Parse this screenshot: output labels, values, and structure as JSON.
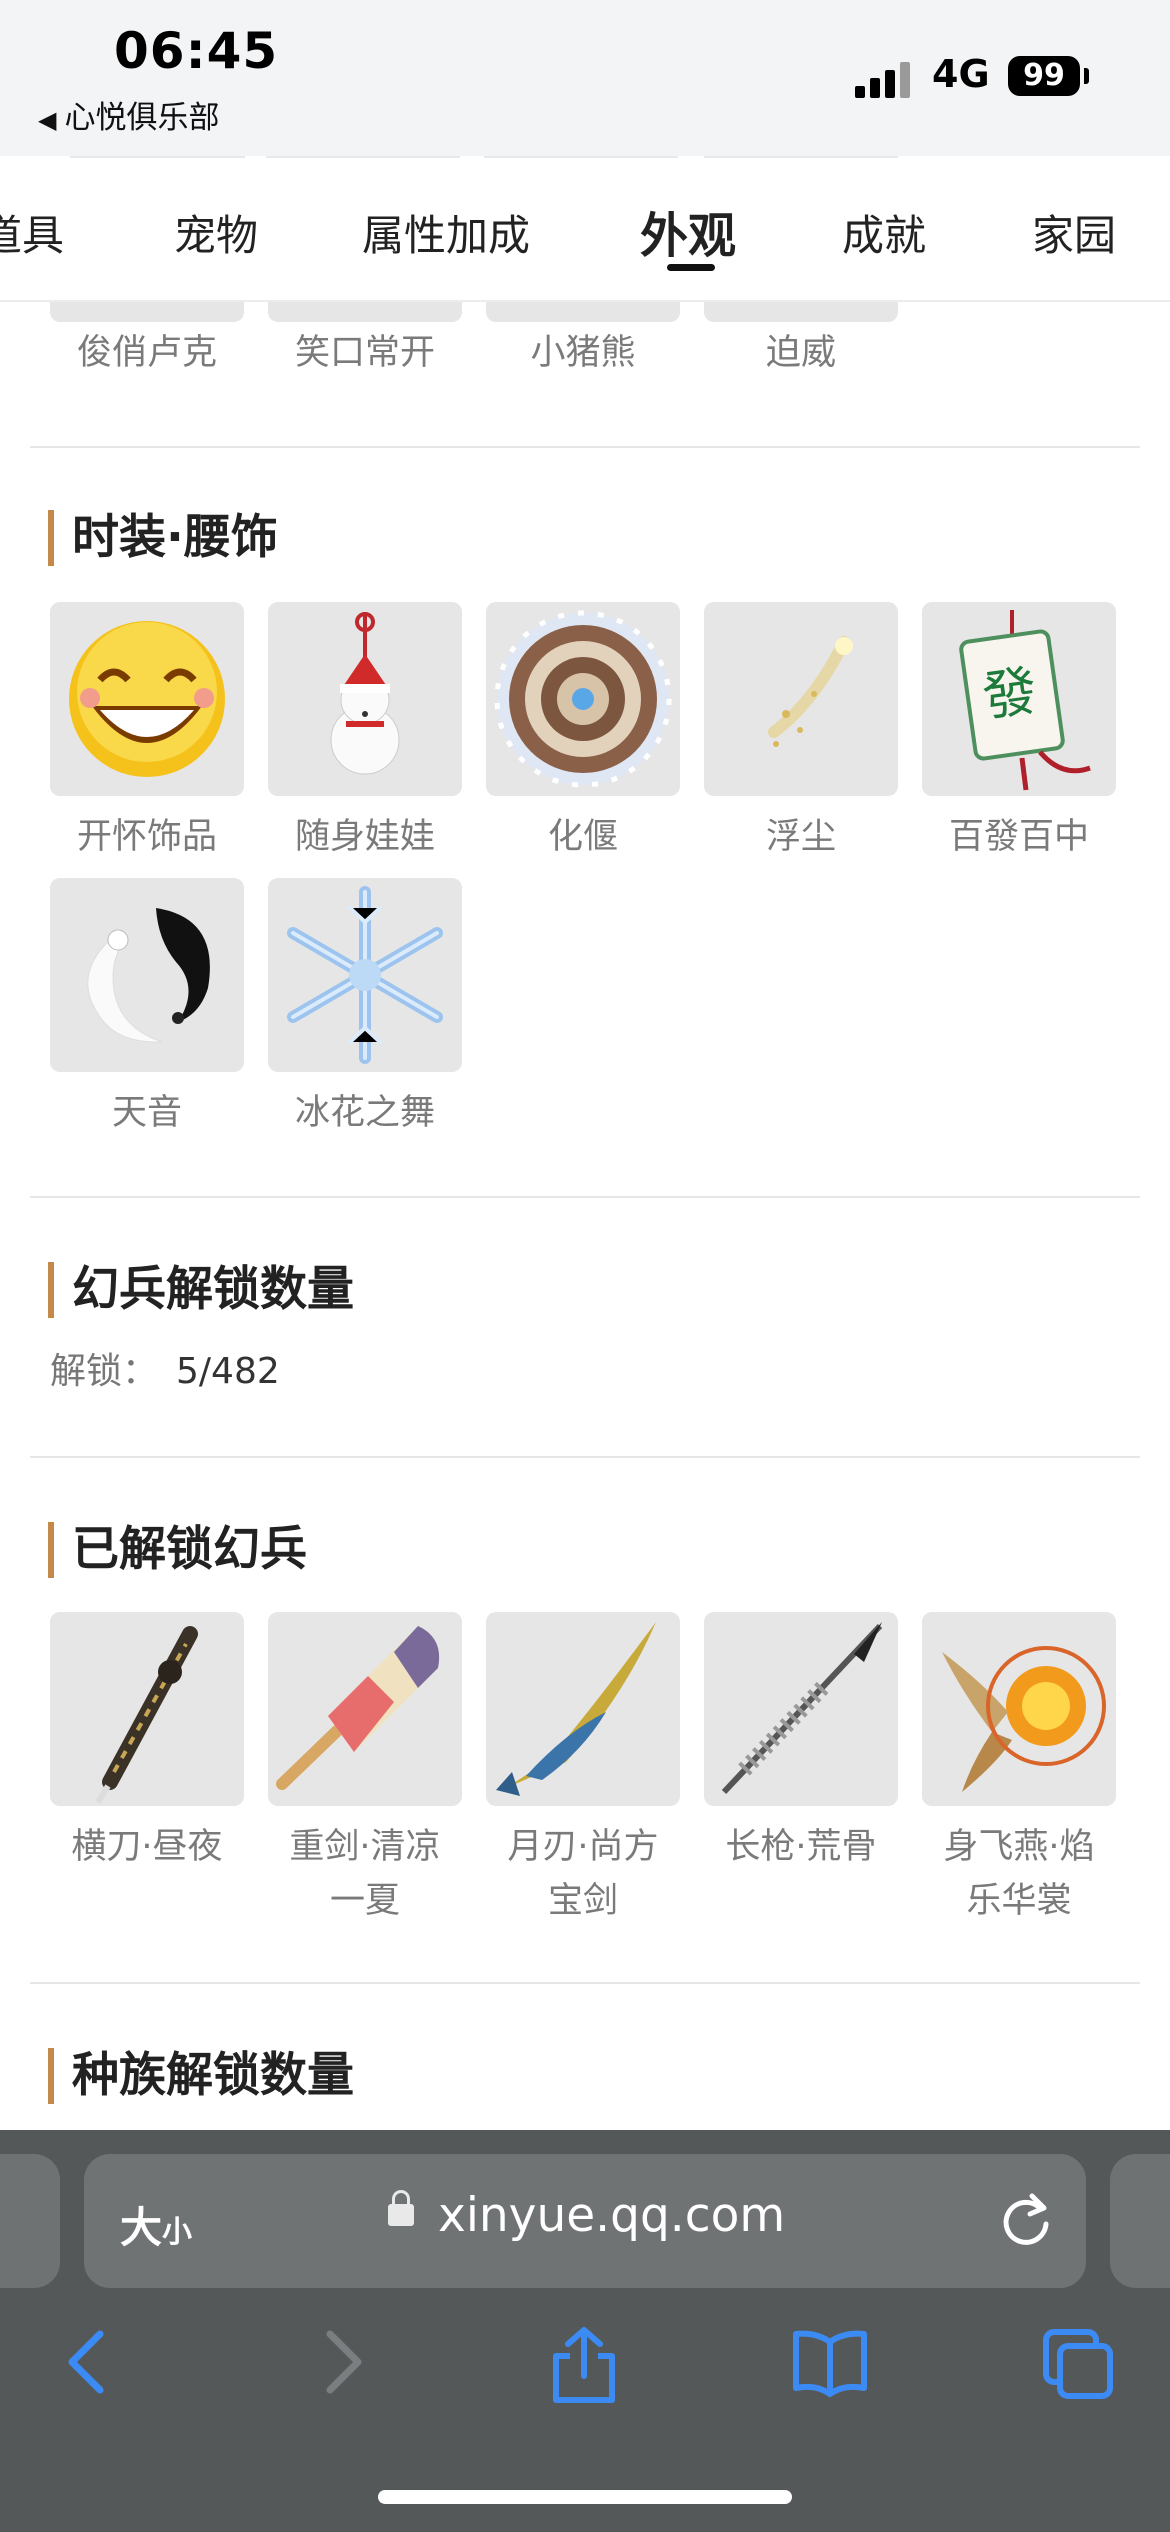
{
  "status_bar": {
    "time": "06:45",
    "back_label": "心悦俱乐部",
    "network": "4G",
    "battery": "99"
  },
  "tabs": [
    {
      "label": "道具",
      "active": false
    },
    {
      "label": "宠物",
      "active": false
    },
    {
      "label": "属性加成",
      "active": false
    },
    {
      "label": "外观",
      "active": true
    },
    {
      "label": "成就",
      "active": false
    },
    {
      "label": "家园",
      "active": false
    }
  ],
  "prev_row": {
    "items": [
      "俊俏卢克",
      "笑口常开",
      "小猪熊",
      "迫威"
    ]
  },
  "waist_section": {
    "title": "时装·腰饰",
    "items": [
      {
        "label": "开怀饰品",
        "icon": "smiley-face-icon"
      },
      {
        "label": "随身娃娃",
        "icon": "snowman-doll-icon"
      },
      {
        "label": "化偃",
        "icon": "mechanism-disc-icon"
      },
      {
        "label": "浮尘",
        "icon": "dust-sparkle-icon"
      },
      {
        "label": "百發百中",
        "icon": "mahjong-tile-icon"
      },
      {
        "label": "天音",
        "icon": "yin-yang-icon"
      },
      {
        "label": "冰花之舞",
        "icon": "snowflake-icon"
      }
    ]
  },
  "weapon_count_section": {
    "title": "幻兵解锁数量",
    "unlock_label": "解锁：",
    "unlock_value": "5/482"
  },
  "weapons_section": {
    "title": "已解锁幻兵",
    "items": [
      {
        "label_line1": "横刀·昼夜",
        "label_line2": "",
        "icon": "saber-icon"
      },
      {
        "label_line1": "重剑·清凉",
        "label_line2": "一夏",
        "icon": "popsicle-sword-icon"
      },
      {
        "label_line1": "月刃·尚方",
        "label_line2": "宝剑",
        "icon": "fish-blade-icon"
      },
      {
        "label_line1": "长枪·荒骨",
        "label_line2": "",
        "icon": "bone-spear-icon"
      },
      {
        "label_line1": "身飞燕·焰",
        "label_line2": "乐华裳",
        "icon": "flame-swallow-icon"
      }
    ]
  },
  "race_section": {
    "title": "种族解锁数量"
  },
  "browser": {
    "text_size_label": "大",
    "text_size_small": "小",
    "url": "xinyue.qq.com"
  }
}
